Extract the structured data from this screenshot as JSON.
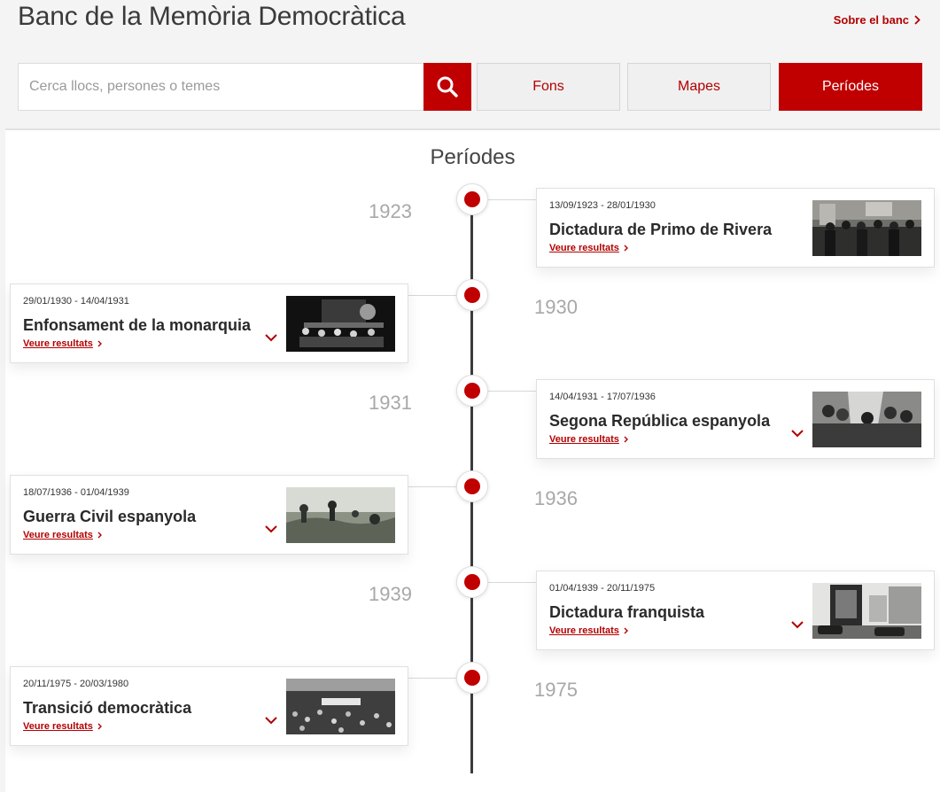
{
  "header": {
    "site_title": "Banc de la Memòria Democràtica",
    "about_link": "Sobre el banc"
  },
  "search": {
    "placeholder": "Cerca llocs, persones o temes",
    "value": ""
  },
  "nav": {
    "fons": "Fons",
    "mapes": "Mapes",
    "periodes": "Períodes"
  },
  "timeline": {
    "title": "Períodes",
    "results_label": "Veure resultats",
    "periods": [
      {
        "year": "1923",
        "dates": "13/09/1923 - 28/01/1930",
        "title": "Dictadura de Primo de Rivera",
        "expandable": false
      },
      {
        "year": "1930",
        "dates": "29/01/1930 - 14/04/1931",
        "title": "Enfonsament de la monarquia",
        "expandable": true
      },
      {
        "year": "1931",
        "dates": "14/04/1931 - 17/07/1936",
        "title": "Segona República espanyola",
        "expandable": true
      },
      {
        "year": "1936",
        "dates": "18/07/1936 - 01/04/1939",
        "title": "Guerra Civil espanyola",
        "expandable": true
      },
      {
        "year": "1939",
        "dates": "01/04/1939 - 20/11/1975",
        "title": "Dictadura franquista",
        "expandable": true
      },
      {
        "year": "1975",
        "dates": "20/11/1975 - 20/03/1980",
        "title": "Transició democràtica",
        "expandable": true
      }
    ]
  },
  "colors": {
    "accent": "#c00000",
    "link": "#b30000",
    "year": "#a8a8a8",
    "line": "#3c3c3c"
  },
  "icons": {
    "search": "search-icon",
    "chevron_right": "chevron-right-icon",
    "chevron_down": "chevron-down-icon"
  }
}
